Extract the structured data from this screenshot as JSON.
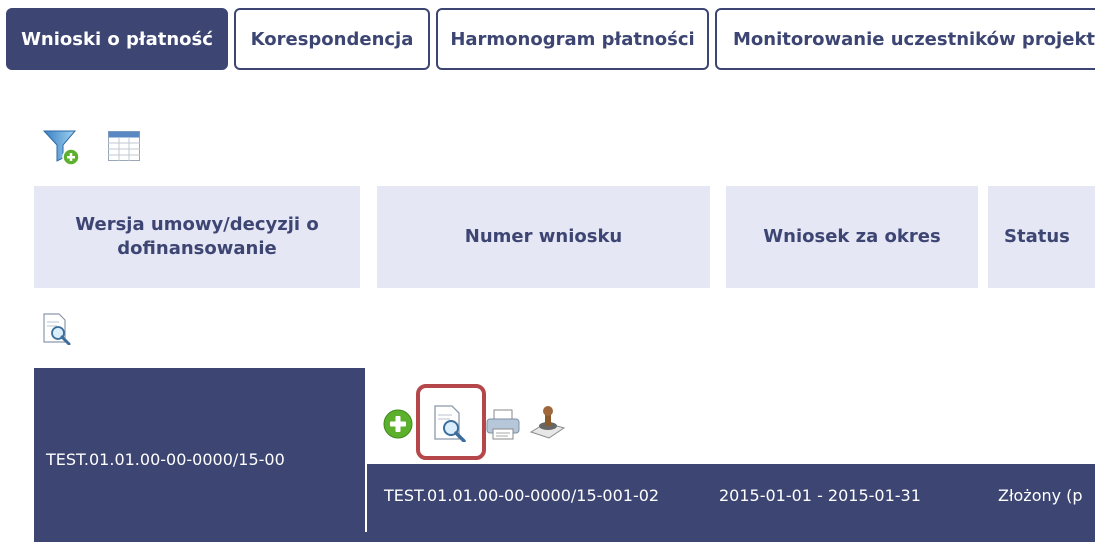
{
  "tabs": [
    {
      "label": "Wnioski o płatność",
      "active": true
    },
    {
      "label": "Korespondencja",
      "active": false
    },
    {
      "label": "Harmonogram płatności",
      "active": false
    },
    {
      "label": "Monitorowanie uczestników projekt",
      "active": false
    }
  ],
  "toolbar": {
    "icons": [
      "filter-add-icon",
      "table-columns-icon"
    ]
  },
  "table": {
    "headers": [
      "Wersja umowy/decyzji o dofinansowanie",
      "Numer wniosku",
      "Wniosek za okres",
      "Status"
    ],
    "preview_icon": "preview-icon",
    "row": {
      "contract": "TEST.01.01.00-00-0000/15-00",
      "actions": [
        "add-icon",
        "preview-icon",
        "print-icon",
        "stamp-icon"
      ],
      "subrow": {
        "number": "TEST.01.01.00-00-0000/15-001-02",
        "period": "2015-01-01 - 2015-01-31",
        "status": "Złożony (p"
      }
    }
  },
  "colors": {
    "primary": "#3d4573",
    "header_bg": "#e6e7f5",
    "highlight": "#b5474a",
    "add_green": "#5cb02c"
  }
}
